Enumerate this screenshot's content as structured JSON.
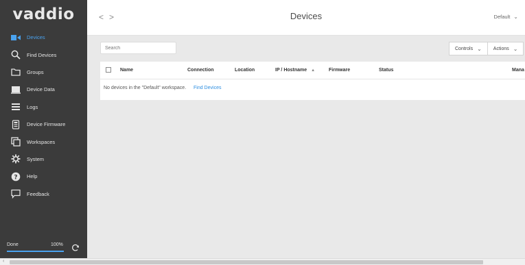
{
  "app": {
    "logo": "vaddio"
  },
  "sidebar": {
    "items": [
      {
        "label": "Devices",
        "icon": "video-camera-icon",
        "active": true
      },
      {
        "label": "Find Devices",
        "icon": "search-icon",
        "active": false
      },
      {
        "label": "Groups",
        "icon": "folder-icon",
        "active": false
      },
      {
        "label": "Device Data",
        "icon": "device-data-icon",
        "active": false
      },
      {
        "label": "Logs",
        "icon": "list-icon",
        "active": false
      },
      {
        "label": "Device Firmware",
        "icon": "firmware-icon",
        "active": false
      },
      {
        "label": "Workspaces",
        "icon": "workspaces-icon",
        "active": false
      },
      {
        "label": "System",
        "icon": "gear-icon",
        "active": false
      },
      {
        "label": "Help",
        "icon": "help-icon",
        "active": false
      },
      {
        "label": "Feedback",
        "icon": "feedback-icon",
        "active": false
      }
    ],
    "footer": {
      "status": "Done",
      "percent_label": "100%",
      "progress": 1.0
    }
  },
  "topbar": {
    "back": "<",
    "forward": ">",
    "title": "Devices",
    "workspace": "Default"
  },
  "toolbar": {
    "search_placeholder": "Search",
    "controls_label": "Controls",
    "actions_label": "Actions"
  },
  "table": {
    "columns": [
      "Name",
      "Connection",
      "Location",
      "IP / Hostname",
      "Firmware",
      "Status",
      "Mana"
    ],
    "empty_message": "No devices in the \"Default\" workspace.",
    "empty_link": "Find Devices"
  },
  "colors": {
    "accent": "#4aa3f0",
    "link": "#2b8de0",
    "sidebar_bg": "#3b3b3b"
  }
}
